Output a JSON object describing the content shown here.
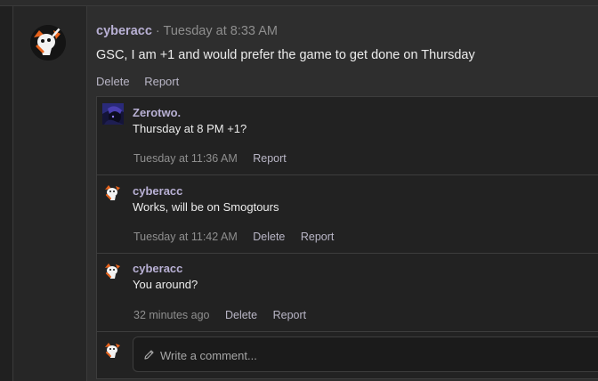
{
  "post": {
    "username": "cyberacc",
    "separator": "·",
    "timestamp": "Tuesday at 8:33 AM",
    "text": "GSC, I am +1 and would prefer the game to get done on Thursday",
    "actions": {
      "delete": "Delete",
      "report": "Report"
    },
    "avatar_icon": "cartoon-avatar-icon"
  },
  "comments": [
    {
      "username": "Zerotwo.",
      "text": "Thursday at 8 PM +1?",
      "time": "Tuesday at 11:36 AM",
      "report": "Report",
      "avatar_icon": "dark-anime-avatar-icon"
    },
    {
      "username": "cyberacc",
      "text": "Works, will be on Smogtours",
      "time": "Tuesday at 11:42 AM",
      "delete": "Delete",
      "report": "Report",
      "avatar_icon": "cartoon-avatar-icon"
    },
    {
      "username": "cyberacc",
      "text": "You around?",
      "time": "32 minutes ago",
      "delete": "Delete",
      "report": "Report",
      "avatar_icon": "cartoon-avatar-icon"
    }
  ],
  "compose": {
    "placeholder": "Write a comment...",
    "icon": "pencil-icon"
  },
  "colors": {
    "username": "#b8b0d4",
    "action_link": "#b9b6c6",
    "meta": "#8f8f8f",
    "avatar_accent": "#e8631c"
  }
}
